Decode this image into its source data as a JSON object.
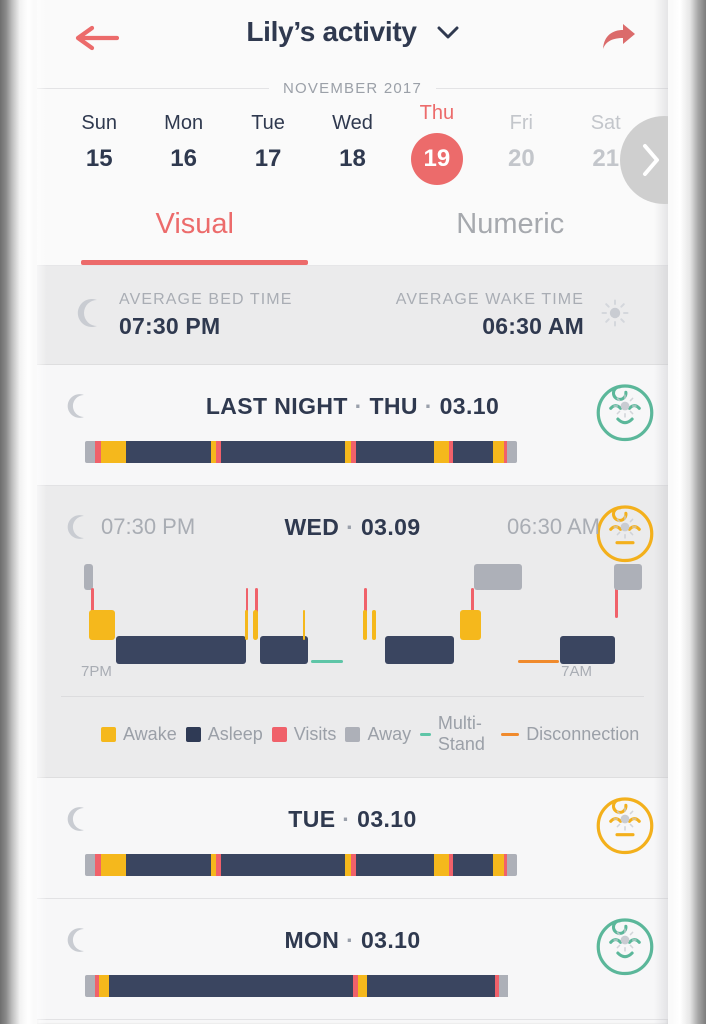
{
  "nav": {
    "back_icon": "arrow-left-icon",
    "title": "Lily’s activity",
    "chevron_icon": "chevron-down-icon",
    "share_icon": "share-arrow-icon",
    "accent": "#ec6b6b"
  },
  "calendar": {
    "month_label": "NOVEMBER 2017",
    "next_icon": "chevron-right-icon",
    "days": [
      {
        "name": "Sun",
        "num": "15",
        "state": "normal"
      },
      {
        "name": "Mon",
        "num": "16",
        "state": "normal"
      },
      {
        "name": "Tue",
        "num": "17",
        "state": "normal"
      },
      {
        "name": "Wed",
        "num": "18",
        "state": "normal"
      },
      {
        "name": "Thu",
        "num": "19",
        "state": "selected"
      },
      {
        "name": "Fri",
        "num": "20",
        "state": "muted"
      },
      {
        "name": "Sat",
        "num": "21",
        "state": "muted"
      }
    ]
  },
  "tabs": [
    {
      "label": "Visual",
      "active": true
    },
    {
      "label": "Numeric",
      "active": false
    }
  ],
  "averages": {
    "moon_icon": "moon-icon",
    "sun_icon": "sun-icon",
    "bed_label": "AVERAGE BED TIME",
    "bed_value": "07:30 PM",
    "wake_label": "AVERAGE WAKE TIME",
    "wake_value": "06:30 AM"
  },
  "legend": {
    "items": [
      {
        "label": "Awake",
        "color": "#f5b81c",
        "shape": "square"
      },
      {
        "label": "Asleep",
        "color": "#2f3a55",
        "shape": "square"
      },
      {
        "label": "Visits",
        "color": "#f0616a",
        "shape": "square"
      },
      {
        "label": "Away",
        "color": "#adb0b8",
        "shape": "square"
      },
      {
        "label": "Multi-Stand",
        "color": "#5ec5a7",
        "shape": "line"
      },
      {
        "label": "Disconnection",
        "color": "#f08a2c",
        "shape": "line"
      }
    ]
  },
  "nights": [
    {
      "id": "last-night",
      "kind": "simple",
      "title_prefix": "LAST NIGHT",
      "weekday": "THU",
      "date": "03.10",
      "moon_icon": "moon-icon",
      "sun_icon": "sun-icon",
      "face_icon": "baby-face-happy-icon",
      "face_color": "#5bb79a",
      "chart_data": {
        "type": "bar",
        "title": "LAST NIGHT · THU · 03.10",
        "orientation": "horizontal-stacked",
        "total_width_pct": 100,
        "segments": [
          {
            "state": "Away",
            "color": "#adb0b8",
            "pct": 2.4
          },
          {
            "state": "Visits",
            "color": "#f0616a",
            "pct": 1.2
          },
          {
            "state": "Awake",
            "color": "#f5b81c",
            "pct": 5.8
          },
          {
            "state": "Asleep",
            "color": "#3a4560",
            "pct": 19.8
          },
          {
            "state": "Awake",
            "color": "#f5b81c",
            "pct": 1.2
          },
          {
            "state": "Visits",
            "color": "#f0616a",
            "pct": 1.0
          },
          {
            "state": "Asleep",
            "color": "#3a4560",
            "pct": 16.6
          },
          {
            "state": "Asleep",
            "color": "#3a4560",
            "pct": 12.2
          },
          {
            "state": "Awake",
            "color": "#f5b81c",
            "pct": 1.4
          },
          {
            "state": "Visits",
            "color": "#f0616a",
            "pct": 1.1
          },
          {
            "state": "Asleep",
            "color": "#3a4560",
            "pct": 18.0
          },
          {
            "state": "Awake",
            "color": "#f5b81c",
            "pct": 3.6
          },
          {
            "state": "Visits",
            "color": "#f0616a",
            "pct": 1.0
          },
          {
            "state": "Asleep",
            "color": "#3a4560",
            "pct": 9.2
          },
          {
            "state": "Awake",
            "color": "#f5b81c",
            "pct": 2.4
          },
          {
            "state": "Visits",
            "color": "#f0616a",
            "pct": 0.9
          },
          {
            "state": "Away",
            "color": "#adb0b8",
            "pct": 2.2
          }
        ]
      }
    },
    {
      "id": "wed",
      "kind": "detail",
      "weekday": "WED",
      "date": "03.09",
      "bed_time": "07:30 PM",
      "wake_time": "06:30 AM",
      "moon_icon": "moon-icon",
      "sun_icon": "sun-icon",
      "face_icon": "baby-face-neutral-icon",
      "face_color": "#f3b01c",
      "chart_data": {
        "type": "timeline",
        "title": "WED · 03.09",
        "xlabels": [
          "7PM",
          "7AM"
        ],
        "x_start": "7PM",
        "x_end": "7AM",
        "lanes": {
          "away": "top",
          "visits": "upper",
          "awake": "middle",
          "asleep": "lower",
          "multistand": "bottom",
          "disconnection": "bottom"
        },
        "events": [
          {
            "state": "Away",
            "color": "#adb0b8",
            "x_pct": 1.0,
            "w_pct": 2.6,
            "lane": "away"
          },
          {
            "state": "Visits",
            "color": "#f0616a",
            "x_pct": 3.0,
            "w_pct": 0.9,
            "lane": "visits"
          },
          {
            "state": "Awake",
            "color": "#f5b81c",
            "x_pct": 2.6,
            "w_pct": 7.8,
            "lane": "awake"
          },
          {
            "state": "Asleep",
            "color": "#3a4560",
            "x_pct": 10.6,
            "w_pct": 40.0,
            "lane": "asleep"
          },
          {
            "state": "Visits",
            "color": "#f0616a",
            "x_pct": 50.5,
            "w_pct": 0.9,
            "lane": "visits"
          },
          {
            "state": "Visits",
            "color": "#f0616a",
            "x_pct": 53.3,
            "w_pct": 0.9,
            "lane": "visits"
          },
          {
            "state": "Awake",
            "color": "#f5b81c",
            "x_pct": 50.3,
            "w_pct": 1.1,
            "lane": "awake"
          },
          {
            "state": "Awake",
            "color": "#f5b81c",
            "x_pct": 52.7,
            "w_pct": 1.5,
            "lane": "awake"
          },
          {
            "state": "Asleep",
            "color": "#3a4560",
            "x_pct": 55.0,
            "w_pct": 14.8,
            "lane": "asleep"
          },
          {
            "state": "Awake",
            "color": "#f5b81c",
            "x_pct": 68.0,
            "w_pct": 0.8,
            "lane": "awake"
          },
          {
            "state": "Multi-Stand",
            "color": "#5ec5a7",
            "x_pct": 70.5,
            "w_pct": 10.0,
            "lane": "multistand"
          },
          {
            "state": "Visits",
            "color": "#f0616a",
            "x_pct": 87.0,
            "w_pct": 0.9,
            "lane": "visits"
          },
          {
            "state": "Awake",
            "color": "#f5b81c",
            "x_pct": 86.5,
            "w_pct": 1.2,
            "lane": "awake"
          },
          {
            "state": "Awake",
            "color": "#f5b81c",
            "x_pct": 89.2,
            "w_pct": 1.4,
            "lane": "awake"
          }
        ],
        "events_right": [
          {
            "state": "Asleep",
            "color": "#3a4560",
            "x_pct": 0.0,
            "w_pct": 24.5,
            "lane": "asleep"
          },
          {
            "state": "Visits",
            "color": "#f0616a",
            "x_pct": 30.5,
            "w_pct": 1.0,
            "lane": "visits"
          },
          {
            "state": "Awake",
            "color": "#f5b81c",
            "x_pct": 26.5,
            "w_pct": 7.5,
            "lane": "awake"
          },
          {
            "state": "Away",
            "color": "#adb0b8",
            "x_pct": 31.5,
            "w_pct": 17.0,
            "lane": "away"
          },
          {
            "state": "Disconnection",
            "color": "#f08a2c",
            "x_pct": 47.0,
            "w_pct": 14.5,
            "lane": "bottom"
          },
          {
            "state": "Asleep",
            "color": "#3a4560",
            "x_pct": 62.0,
            "w_pct": 19.5,
            "lane": "asleep"
          },
          {
            "state": "Visits",
            "color": "#f0616a",
            "x_pct": 81.5,
            "w_pct": 0.9,
            "lane": "visits"
          },
          {
            "state": "Away",
            "color": "#adb0b8",
            "x_pct": 81.0,
            "w_pct": 10.0,
            "lane": "away"
          }
        ]
      }
    },
    {
      "id": "tue",
      "kind": "simple",
      "title_prefix": "",
      "weekday": "TUE",
      "date": "03.10",
      "moon_icon": "moon-icon",
      "sun_icon": "sun-icon",
      "face_icon": "baby-face-neutral-icon",
      "face_color": "#f3b01c",
      "chart_data": {
        "type": "bar",
        "title": "TUE · 03.10",
        "orientation": "horizontal-stacked",
        "segments": [
          {
            "state": "Away",
            "color": "#adb0b8",
            "pct": 2.4
          },
          {
            "state": "Visits",
            "color": "#f0616a",
            "pct": 1.2
          },
          {
            "state": "Awake",
            "color": "#f5b81c",
            "pct": 5.8
          },
          {
            "state": "Asleep",
            "color": "#3a4560",
            "pct": 19.8
          },
          {
            "state": "Awake",
            "color": "#f5b81c",
            "pct": 1.2
          },
          {
            "state": "Visits",
            "color": "#f0616a",
            "pct": 1.0
          },
          {
            "state": "Asleep",
            "color": "#3a4560",
            "pct": 16.6
          },
          {
            "state": "Asleep",
            "color": "#3a4560",
            "pct": 12.2
          },
          {
            "state": "Awake",
            "color": "#f5b81c",
            "pct": 1.4
          },
          {
            "state": "Visits",
            "color": "#f0616a",
            "pct": 1.1
          },
          {
            "state": "Asleep",
            "color": "#3a4560",
            "pct": 18.0
          },
          {
            "state": "Awake",
            "color": "#f5b81c",
            "pct": 3.6
          },
          {
            "state": "Visits",
            "color": "#f0616a",
            "pct": 1.0
          },
          {
            "state": "Asleep",
            "color": "#3a4560",
            "pct": 9.2
          },
          {
            "state": "Awake",
            "color": "#f5b81c",
            "pct": 2.4
          },
          {
            "state": "Visits",
            "color": "#f0616a",
            "pct": 0.9
          },
          {
            "state": "Away",
            "color": "#adb0b8",
            "pct": 2.2
          }
        ]
      }
    },
    {
      "id": "mon",
      "kind": "simple",
      "title_prefix": "",
      "weekday": "MON",
      "date": "03.10",
      "moon_icon": "moon-icon",
      "sun_icon": "sun-icon",
      "face_icon": "baby-face-happy-icon",
      "face_color": "#5bb79a",
      "chart_data": {
        "type": "bar",
        "title": "MON · 03.10",
        "orientation": "horizontal-stacked",
        "segments": [
          {
            "state": "Away",
            "color": "#adb0b8",
            "pct": 2.2
          },
          {
            "state": "Visits",
            "color": "#f0616a",
            "pct": 1.0
          },
          {
            "state": "Awake",
            "color": "#f5b81c",
            "pct": 2.4
          },
          {
            "state": "Asleep",
            "color": "#3a4560",
            "pct": 56.5
          },
          {
            "state": "Visits",
            "color": "#f0616a",
            "pct": 1.0
          },
          {
            "state": "Awake",
            "color": "#f5b81c",
            "pct": 2.2
          },
          {
            "state": "Asleep",
            "color": "#3a4560",
            "pct": 29.6
          },
          {
            "state": "Visits",
            "color": "#f0616a",
            "pct": 1.0
          },
          {
            "state": "Away",
            "color": "#adb0b8",
            "pct": 2.1
          }
        ]
      }
    }
  ]
}
